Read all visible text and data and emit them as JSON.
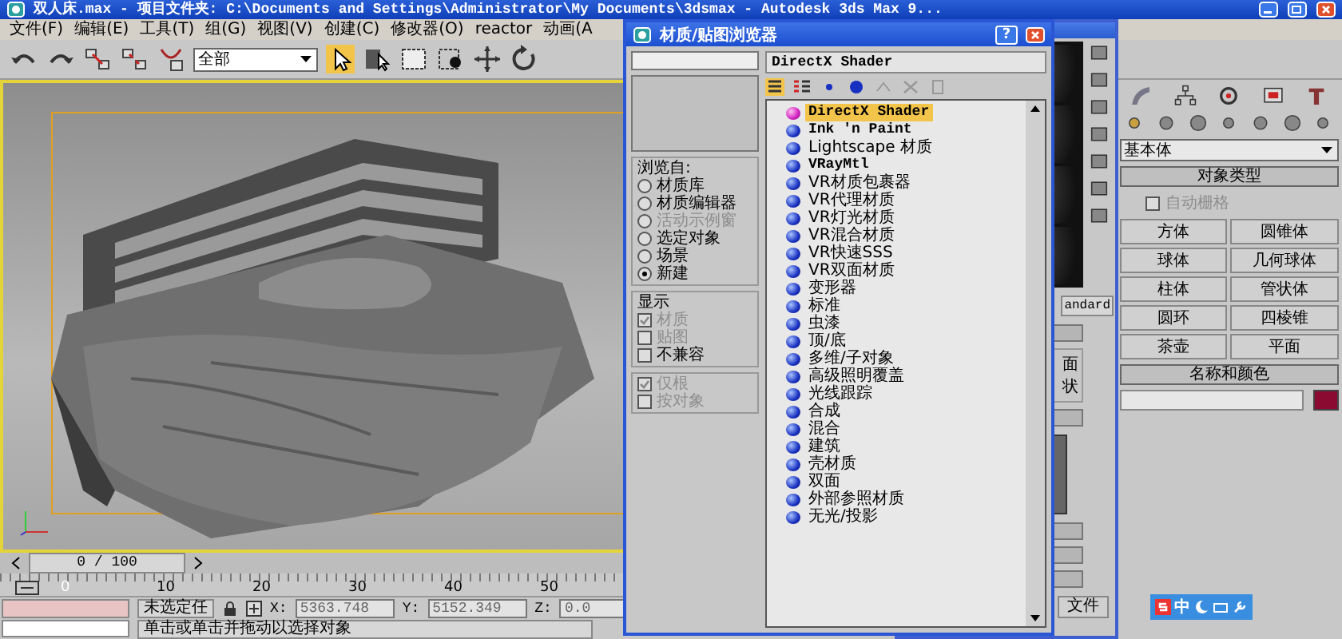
{
  "window": {
    "title": "双人床.max  - 项目文件夹: C:\\Documents and Settings\\Administrator\\My Documents\\3dsmax  - Autodesk 3ds Max 9..."
  },
  "menu": [
    "文件(F)",
    "编辑(E)",
    "工具(T)",
    "组(G)",
    "视图(V)",
    "创建(C)",
    "修改器(O)",
    "reactor",
    "动画(A"
  ],
  "toolbar": {
    "selection_filter": "全部"
  },
  "timeline": {
    "frame": "0 / 100",
    "ticks": [
      "0",
      "10",
      "20",
      "30",
      "40",
      "50"
    ]
  },
  "status": {
    "selection": "未选定任",
    "coords": [
      {
        "label": "X:",
        "value": "5363.748"
      },
      {
        "label": "Y:",
        "value": "5152.349"
      },
      {
        "label": "Z:",
        "value": "0.0"
      }
    ],
    "prompt": "单击或单击并拖动以选择对象"
  },
  "material_editor": {
    "type_button": "andard",
    "texts": [
      "面",
      "状"
    ],
    "file_button": "文件"
  },
  "command_panel": {
    "category": "基本体",
    "object_type_title": "对象类型",
    "autogrid": {
      "label": "自动栅格",
      "checked": false,
      "disabled": true
    },
    "buttons": [
      "方体",
      "圆锥体",
      "球体",
      "几何球体",
      "柱体",
      "管状体",
      "圆环",
      "四棱锥",
      "茶壶",
      "平面"
    ],
    "name_color": {
      "title": "名称和颜色",
      "color": "#8b0a32"
    }
  },
  "ime_bar": {
    "label": "中"
  },
  "dialog": {
    "title": "材质/贴图浏览器",
    "help_button": "?",
    "browse_from": {
      "title": "浏览自:",
      "options": [
        {
          "label": "材质库",
          "selected": false,
          "disabled": false
        },
        {
          "label": "材质编辑器",
          "selected": false,
          "disabled": false
        },
        {
          "label": "活动示例窗",
          "selected": false,
          "disabled": true
        },
        {
          "label": "选定对象",
          "selected": false,
          "disabled": false
        },
        {
          "label": "场景",
          "selected": false,
          "disabled": false
        },
        {
          "label": "新建",
          "selected": true,
          "disabled": false
        }
      ]
    },
    "display": {
      "title": "显示",
      "options": [
        {
          "label": "材质",
          "checked": true,
          "disabled": true
        },
        {
          "label": "贴图",
          "checked": false,
          "disabled": true
        },
        {
          "label": "不兼容",
          "checked": false,
          "disabled": false
        }
      ],
      "root_options": [
        {
          "label": "仅根",
          "checked": true,
          "disabled": true
        },
        {
          "label": "按对象",
          "checked": false,
          "disabled": true
        }
      ]
    },
    "current": "DirectX Shader",
    "items": [
      {
        "label": "DirectX Shader",
        "selected": true
      },
      {
        "label": "Ink 'n Paint",
        "selected": false
      },
      {
        "label": "Lightscape 材质",
        "selected": false
      },
      {
        "label": "VRayMtl",
        "selected": false
      },
      {
        "label": "VR材质包裹器",
        "selected": false
      },
      {
        "label": "VR代理材质",
        "selected": false
      },
      {
        "label": "VR灯光材质",
        "selected": false
      },
      {
        "label": "VR混合材质",
        "selected": false
      },
      {
        "label": "VR快速SSS",
        "selected": false
      },
      {
        "label": "VR双面材质",
        "selected": false
      },
      {
        "label": "变形器",
        "selected": false
      },
      {
        "label": "标准",
        "selected": false
      },
      {
        "label": "虫漆",
        "selected": false
      },
      {
        "label": "顶/底",
        "selected": false
      },
      {
        "label": "多维/子对象",
        "selected": false
      },
      {
        "label": "高级照明覆盖",
        "selected": false
      },
      {
        "label": "光线跟踪",
        "selected": false
      },
      {
        "label": "合成",
        "selected": false
      },
      {
        "label": "混合",
        "selected": false
      },
      {
        "label": "建筑",
        "selected": false
      },
      {
        "label": "壳材质",
        "selected": false
      },
      {
        "label": "双面",
        "selected": false
      },
      {
        "label": "外部参照材质",
        "selected": false
      },
      {
        "label": "无光/投影",
        "selected": false
      }
    ]
  }
}
